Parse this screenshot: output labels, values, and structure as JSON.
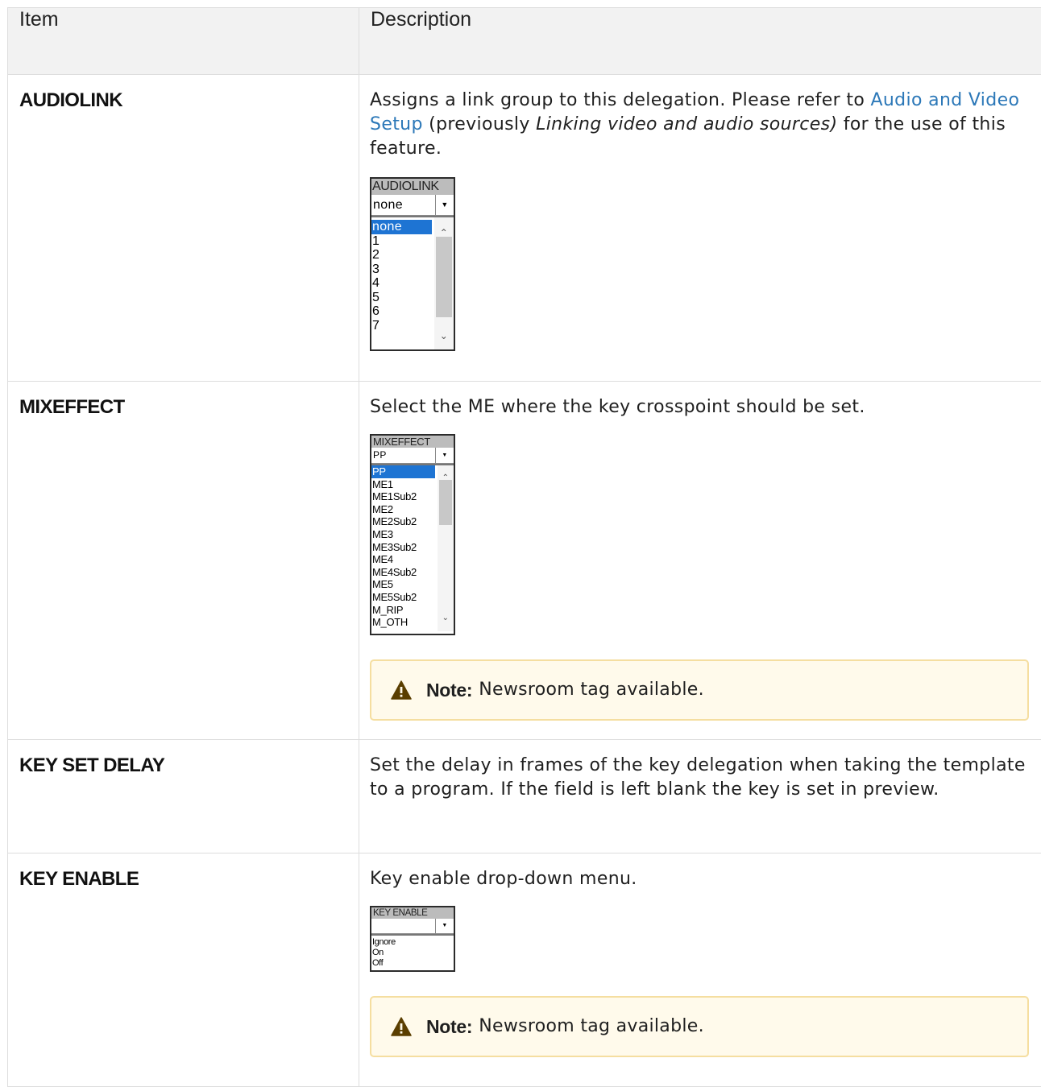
{
  "table": {
    "headers": [
      "Item",
      "Description"
    ],
    "rows": [
      {
        "item": "AUDIOLINK",
        "desc_pre": "Assigns a link group to this delegation. Please refer to ",
        "desc_link": "Audio and Video Setup",
        "desc_mid": " (previously ",
        "desc_italic": "Linking video and audio sources)",
        "desc_post": " for the use of this feature.",
        "widget": {
          "title": "AUDIOLINK",
          "selected": "none",
          "options": [
            "none",
            "1",
            "2",
            "3",
            "4",
            "5",
            "6",
            "7"
          ]
        }
      },
      {
        "item": "MIXEFFECT",
        "desc": "Select the ME where the key crosspoint should be set.",
        "widget": {
          "title": "MIXEFFECT",
          "selected": "PP",
          "options": [
            "PP",
            "ME1",
            "ME1Sub2",
            "ME2",
            "ME2Sub2",
            "ME3",
            "ME3Sub2",
            "ME4",
            "ME4Sub2",
            "ME5",
            "ME5Sub2",
            "M_RIP",
            "M_OTH"
          ]
        },
        "note": {
          "label": "Note:",
          "text": "Newsroom tag available."
        }
      },
      {
        "item": "KEY SET DELAY",
        "desc": "Set the delay in frames of the key delegation when taking the template to a program. If the field is left blank the key is set in preview."
      },
      {
        "item": "KEY ENABLE",
        "desc": "Key enable drop-down menu.",
        "widget": {
          "title": "KEY ENABLE",
          "selected": "",
          "options": [
            "Ignore",
            "On",
            "Off"
          ]
        },
        "note": {
          "label": "Note:",
          "text": "Newsroom tag available."
        }
      }
    ]
  },
  "colors": {
    "link": "#2c78b8",
    "note_border": "#f5dea0",
    "note_bg": "#fffaeb",
    "warning_icon": "#5a3e00"
  },
  "icons": {
    "note": "warning-triangle-icon",
    "dropdown": "chevron-down-icon"
  }
}
